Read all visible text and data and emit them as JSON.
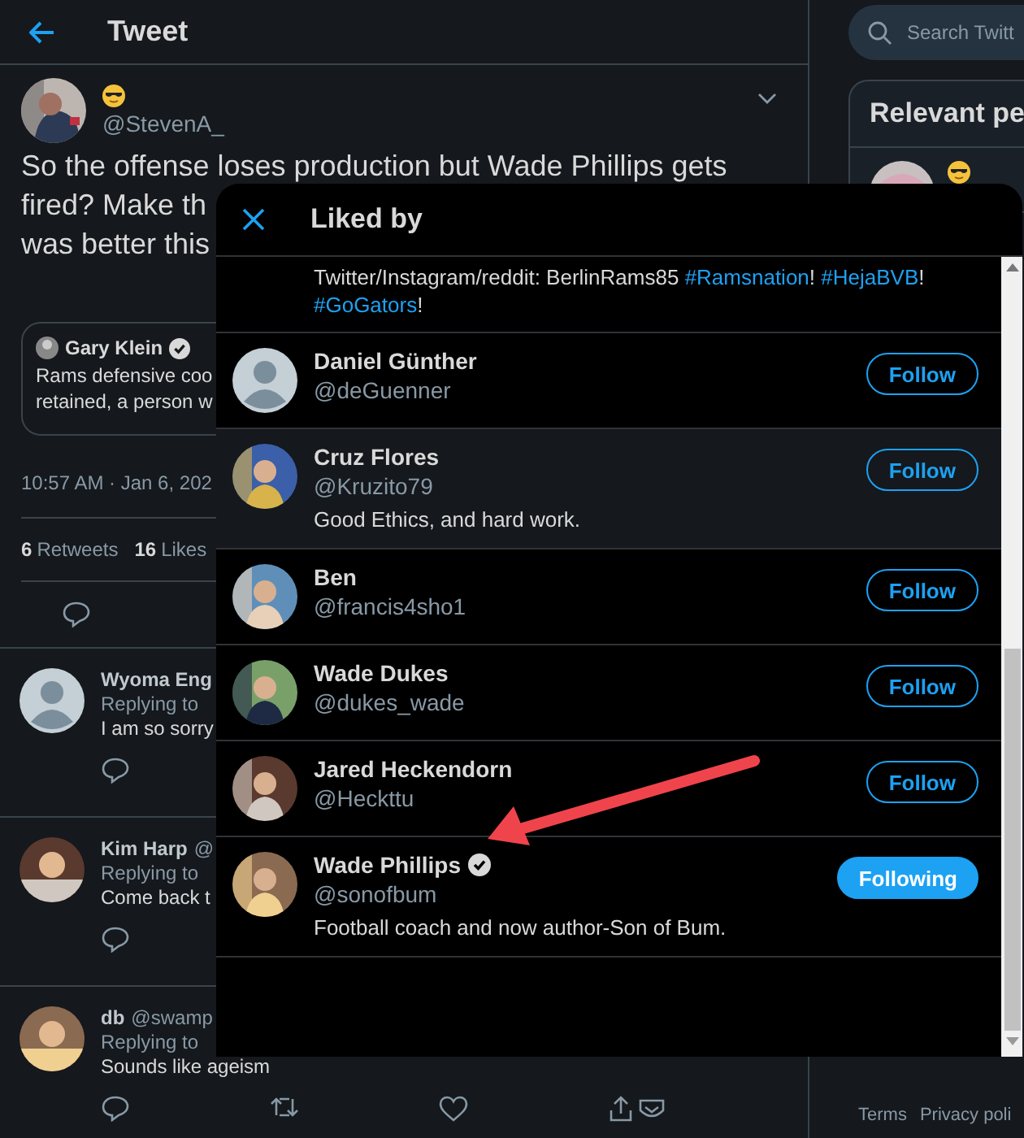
{
  "header": {
    "title": "Tweet"
  },
  "tweet": {
    "handle": "@StevenA_",
    "text_lines": [
      "So the offense loses production but Wade Phillips gets",
      "fired? Make th",
      "was better this"
    ],
    "quote": {
      "name": "Gary Klein",
      "verified": true,
      "lines": [
        "Rams defensive coo",
        "retained, a person w"
      ]
    },
    "timestamp": "10:57 AM · Jan 6, 202",
    "stats": [
      {
        "count": "6",
        "label": "Retweets"
      },
      {
        "count": "16",
        "label": "Likes"
      }
    ]
  },
  "replies": [
    {
      "name": "Wyoma Eng",
      "replying": "Replying to",
      "text": "I am so sorry",
      "default_avatar": true,
      "all_actions": false
    },
    {
      "name": "Kim Harp",
      "handle": "@",
      "replying": "Replying to",
      "text": "Come back t",
      "default_avatar": false,
      "all_actions": false
    },
    {
      "name": "db",
      "handle": "@swamp",
      "replying": "Replying to",
      "text": "Sounds like ageism",
      "default_avatar": false,
      "all_actions": true
    }
  ],
  "sidebar": {
    "search": {
      "placeholder": "Search Twitt"
    },
    "panel_title": "Relevant pe"
  },
  "footer": [
    "Terms",
    "Privacy poli"
  ],
  "modal": {
    "title": "Liked by",
    "partial_bio": [
      [
        {
          "kind": "text",
          "text": "Twitter/Instagram/reddit: BerlinRams85 "
        },
        {
          "kind": "hashtag",
          "text": "#Ramsnation"
        },
        {
          "kind": "text",
          "text": "! "
        },
        {
          "kind": "hashtag",
          "text": "#HejaBVB"
        },
        {
          "kind": "text",
          "text": "!"
        }
      ],
      [
        {
          "kind": "hashtag",
          "text": "#GoGators"
        },
        {
          "kind": "text",
          "text": "!"
        }
      ]
    ],
    "users": [
      {
        "name": "Daniel Günther",
        "handle": "@deGuenner",
        "verified": false,
        "default_avatar": true,
        "hovered": false,
        "following": false,
        "button": "Follow"
      },
      {
        "name": "Cruz Flores",
        "handle": "@Kruzito79",
        "verified": false,
        "bio": "Good Ethics, and hard work.",
        "default_avatar": false,
        "hovered": true,
        "following": false,
        "button": "Follow"
      },
      {
        "name": "Ben",
        "handle": "@francis4sho1",
        "verified": false,
        "default_avatar": false,
        "hovered": false,
        "following": false,
        "button": "Follow"
      },
      {
        "name": "Wade Dukes",
        "handle": "@dukes_wade",
        "verified": false,
        "default_avatar": false,
        "hovered": false,
        "following": false,
        "button": "Follow"
      },
      {
        "name": "Jared Heckendorn",
        "handle": "@Heckttu",
        "verified": false,
        "default_avatar": false,
        "hovered": false,
        "following": false,
        "button": "Follow"
      },
      {
        "name": "Wade Phillips",
        "handle": "@sonofbum",
        "verified": true,
        "bio": "Football coach and now author-Son of Bum.",
        "default_avatar": false,
        "hovered": false,
        "following": true,
        "button": "Following"
      }
    ]
  }
}
